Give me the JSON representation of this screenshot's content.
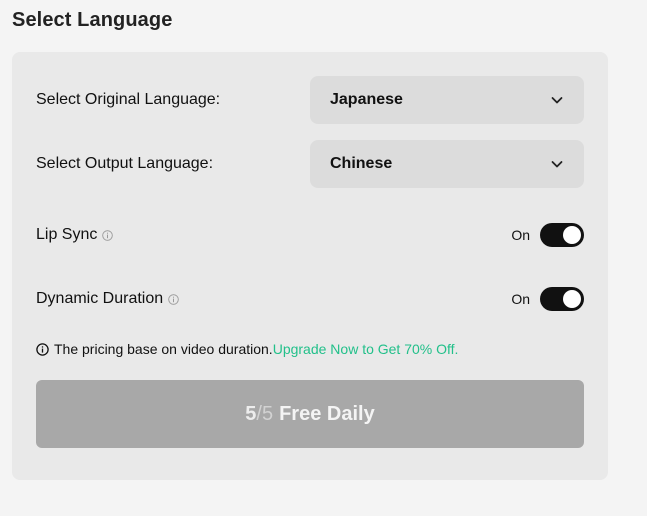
{
  "section": {
    "title": "Select Language"
  },
  "original_language": {
    "label": "Select Original Language:",
    "value": "Japanese"
  },
  "output_language": {
    "label": "Select Output Language:",
    "value": "Chinese"
  },
  "lip_sync": {
    "label": "Lip Sync",
    "state": "On",
    "enabled": true
  },
  "dynamic_duration": {
    "label": "Dynamic Duration",
    "state": "On",
    "enabled": true
  },
  "notice": {
    "text": "The pricing base on video duration.",
    "link": "Upgrade Now to Get 70% Off."
  },
  "free_button": {
    "used": "5",
    "separator": "/",
    "total": "5",
    "label": "Free Daily"
  },
  "colors": {
    "accent_link": "#22c08a",
    "toggle_on": "#111111",
    "button_disabled": "#a8a8a8"
  },
  "icons": {
    "dropdown": "chevron-down-icon",
    "info": "info-icon",
    "notice": "info-circle-icon"
  }
}
